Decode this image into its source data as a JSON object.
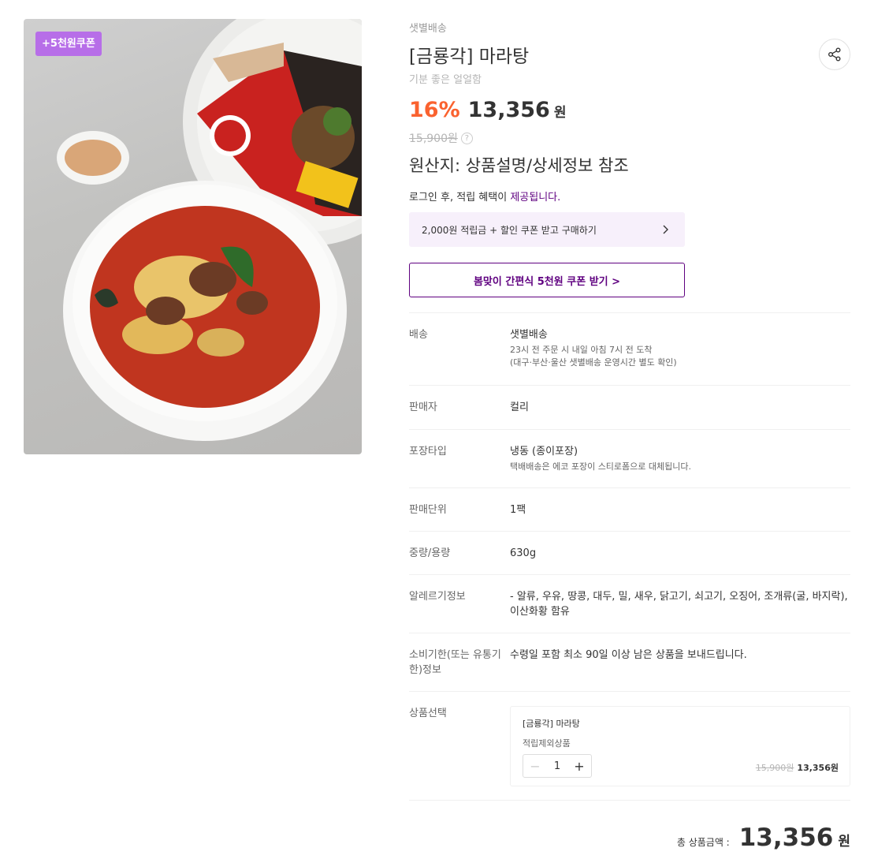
{
  "image": {
    "coupon_badge": "+5천원쿠폰",
    "alt": "food photo"
  },
  "header": {
    "delivery_tag": "샛별배송",
    "title": "[금룡각] 마라탕",
    "subtitle": "기분 좋은 얼얼함",
    "share_icon": "share-icon"
  },
  "price": {
    "discount": "16%",
    "value": "13,356",
    "unit": "원",
    "original": "15,900원",
    "help_icon": "?"
  },
  "origin": "원산지: 상품설명/상세정보 참조",
  "login_note": {
    "prefix": "로그인 후, 적립 혜택이 ",
    "suffix": "제공됩니다."
  },
  "benefit": {
    "label": "2,000원 적립금 + 할인 쿠폰 받고 구매하기"
  },
  "coupon_button": "봄맞이 간편식 5천원 쿠폰 받기 >",
  "details": [
    {
      "label": "배송",
      "value": "샛별배송",
      "sub": [
        "23시 전 주문 시 내일 아침 7시 전 도착",
        "(대구·부산·울산 샛별배송 운영시간 별도 확인)"
      ]
    },
    {
      "label": "판매자",
      "value": "컬리",
      "sub": []
    },
    {
      "label": "포장타입",
      "value": "냉동 (종이포장)",
      "sub": [
        "택배배송은 에코 포장이 스티로폼으로 대체됩니다."
      ]
    },
    {
      "label": "판매단위",
      "value": "1팩",
      "sub": []
    },
    {
      "label": "중량/용량",
      "value": "630g",
      "sub": []
    },
    {
      "label": "알레르기정보",
      "value": "- 알류, 우유, 땅콩, 대두, 밀, 새우, 닭고기, 쇠고기, 오징어, 조개류(굴, 바지락), 이산화황 함유",
      "sub": []
    },
    {
      "label": "소비기한(또는 유통기한)정보",
      "value": "수령일 포함 최소 90일 이상 남은 상품을 보내드립니다.",
      "sub": []
    }
  ],
  "option": {
    "label": "상품선택",
    "name": "[금룡각] 마라탕",
    "sub": "적립제외상품",
    "minus": "−",
    "qty": "1",
    "plus": "+",
    "original": "15,900원",
    "price": "13,356원"
  },
  "total": {
    "label": "총 상품금액 :",
    "value": "13,356",
    "unit": "원"
  },
  "colors": {
    "accent": "#5f0080",
    "discount": "#fa622f",
    "badge": "#b76ee8"
  }
}
